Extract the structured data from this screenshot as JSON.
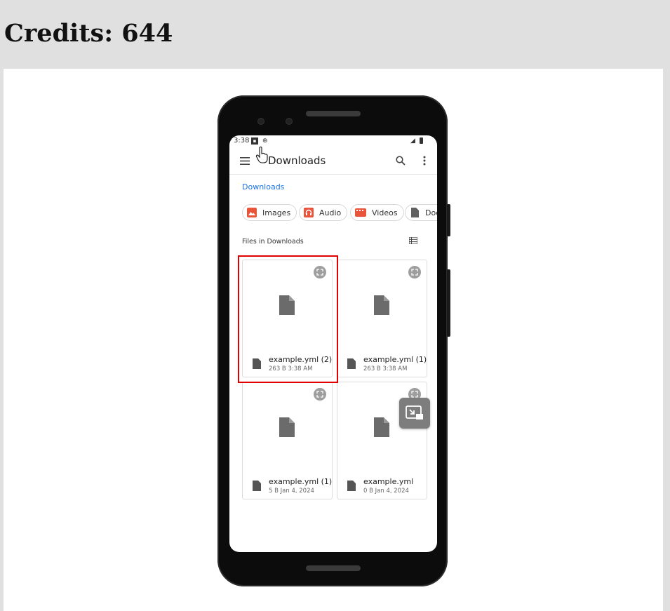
{
  "header": {
    "credits": "Credits: 644"
  },
  "phone": {
    "status_bar": {
      "time": "3:38"
    },
    "app_bar": {
      "title": "Downloads",
      "menu_icon": "hamburger-icon",
      "search_icon": "search-icon",
      "more_icon": "more-vert-icon"
    },
    "breadcrumb": "Downloads",
    "chips": [
      {
        "label": "Images",
        "icon": "image-icon",
        "color": "#e8553a"
      },
      {
        "label": "Audio",
        "icon": "headphones-icon",
        "color": "#e8553a"
      },
      {
        "label": "Videos",
        "icon": "video-icon",
        "color": "#e8553a"
      },
      {
        "label": "Doc",
        "icon": "document-icon",
        "color": "#616161"
      }
    ],
    "files_section": {
      "label": "Files in Downloads",
      "view_toggle_icon": "list-view-icon"
    },
    "files": [
      {
        "name": "example.yml (2)",
        "meta": "263 B 3:38 AM",
        "selected": true
      },
      {
        "name": "example.yml (1)",
        "meta": "263 B 3:38 AM",
        "selected": false
      },
      {
        "name": "example.yml (1)",
        "meta": "5 B Jan 4, 2024",
        "selected": false
      },
      {
        "name": "example.yml",
        "meta": "0 B Jan 4, 2024",
        "selected": false
      }
    ]
  },
  "colors": {
    "accent": "#1a73e8",
    "highlight": "#e00000",
    "background": "#e0e0e0"
  }
}
